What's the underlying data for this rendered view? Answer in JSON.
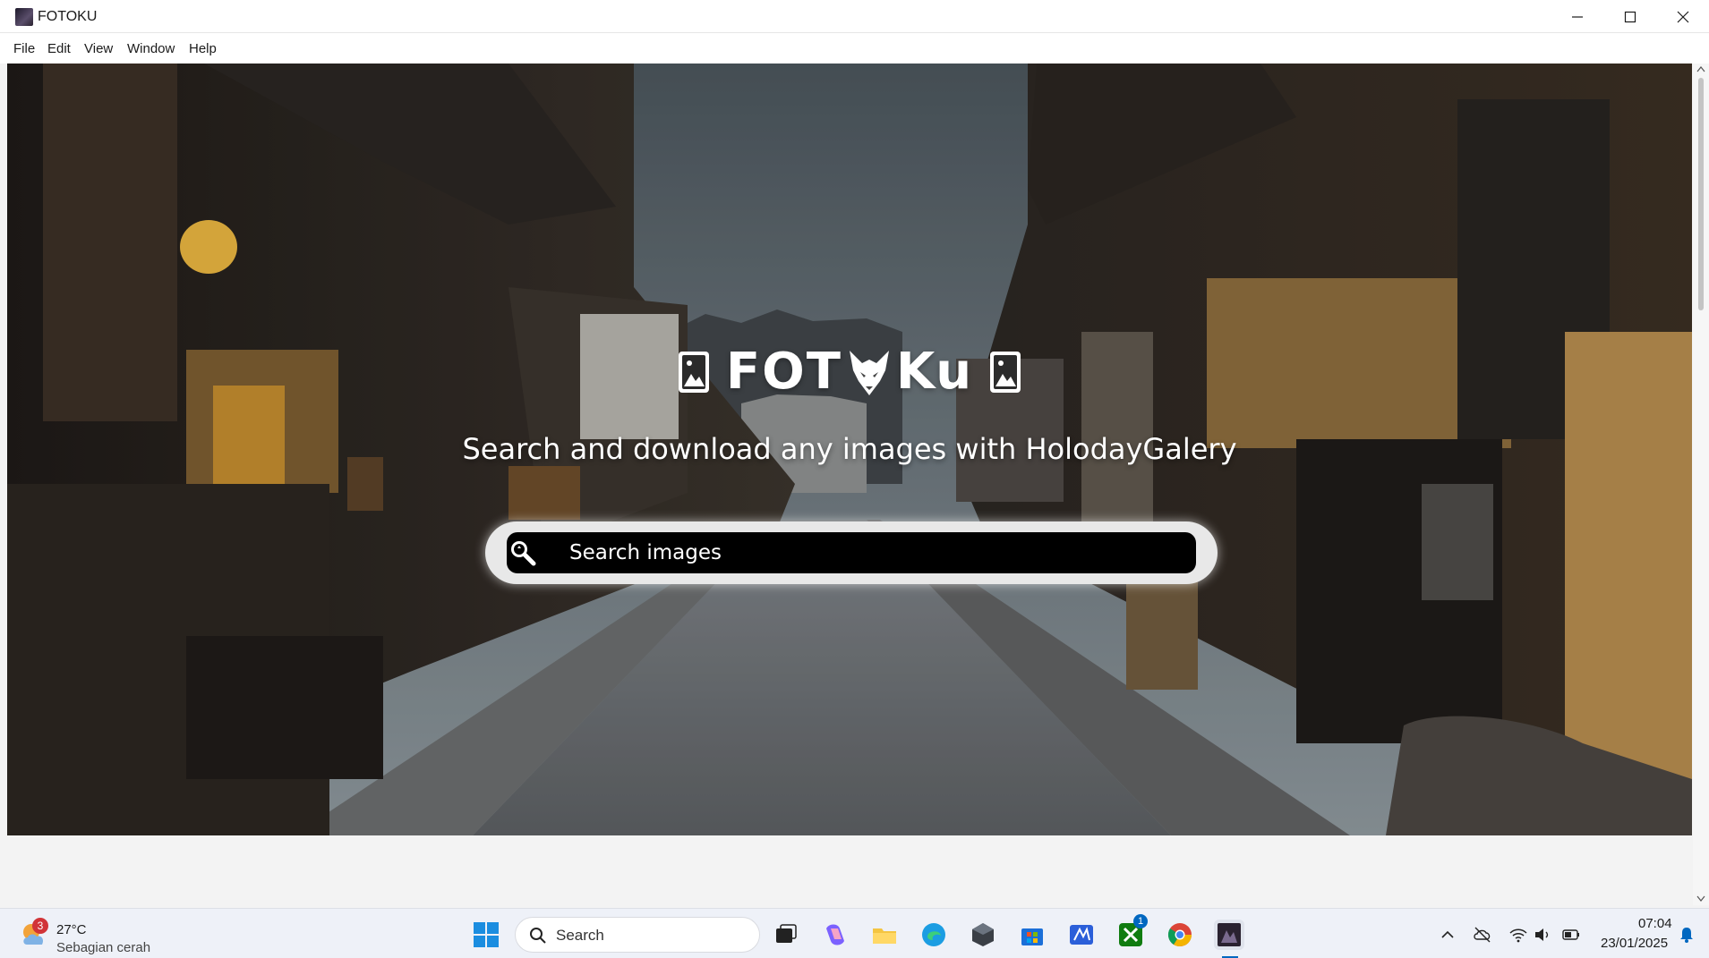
{
  "window": {
    "title": "FOTOKU",
    "minimize_glyph": "minimize-icon",
    "maximize_glyph": "maximize-icon",
    "close_glyph": "close-icon"
  },
  "menu": {
    "items": [
      "File",
      "Edit",
      "View",
      "Window",
      "Help"
    ]
  },
  "hero": {
    "brand_left": "FOT",
    "brand_right": "Ku",
    "tagline": "Search and download any images with HolodayGalery",
    "search_placeholder": "Search images"
  },
  "bottom_nav": {
    "icons": [
      "home-icon",
      "gallery-icon",
      "contrast-icon"
    ]
  },
  "taskbar": {
    "weather_badge": "3",
    "weather_temp": "27°C",
    "weather_desc": "Sebagian cerah",
    "search_label": "Search",
    "store_badge": "1",
    "time": "07:04",
    "date": "23/01/2025"
  },
  "colors": {
    "accent": "#0067c0",
    "nav_bg": "#2d2d2d",
    "search_bg": "#000000"
  }
}
